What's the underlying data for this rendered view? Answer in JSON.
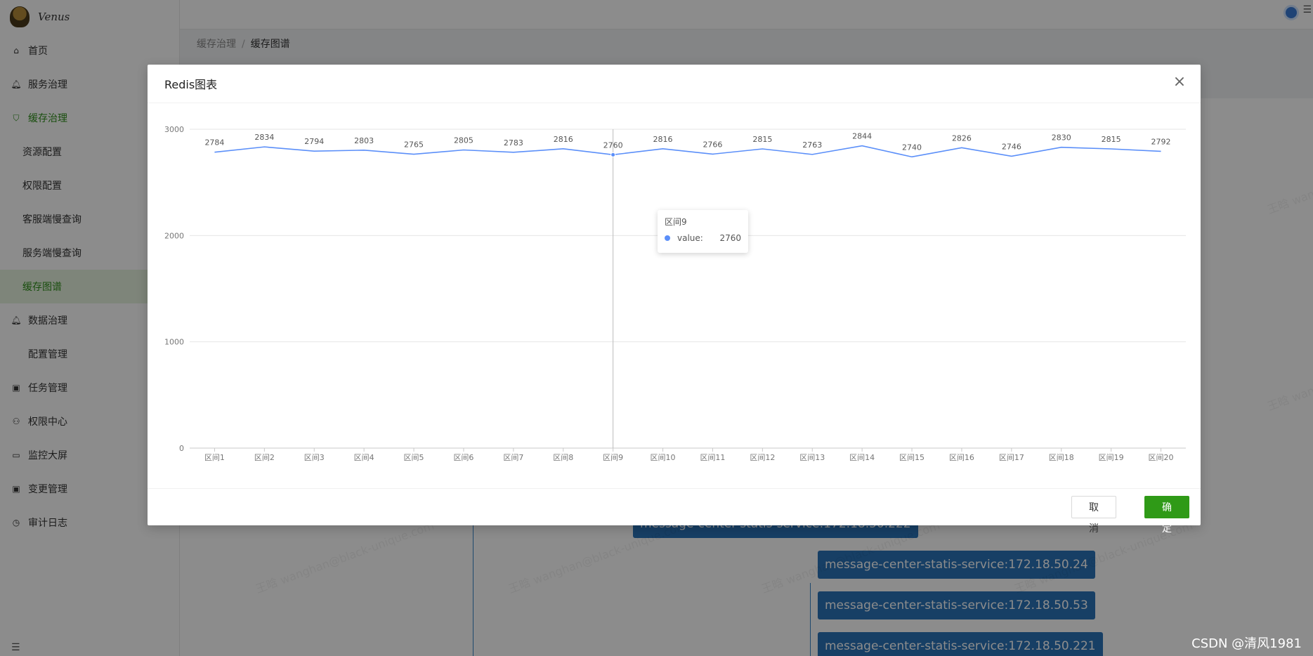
{
  "app": {
    "brand": "Venus"
  },
  "sidebar": {
    "items": [
      {
        "label": "首页",
        "icon": "home-icon"
      },
      {
        "label": "服务治理",
        "icon": "bell-icon"
      },
      {
        "label": "缓存治理",
        "icon": "shield-icon"
      },
      {
        "label": "资源配置"
      },
      {
        "label": "权限配置"
      },
      {
        "label": "客服端慢查询"
      },
      {
        "label": "服务端慢查询"
      },
      {
        "label": "缓存图谱"
      },
      {
        "label": "数据治理",
        "icon": "bell-icon"
      },
      {
        "label": "配置管理",
        "icon": "apple-icon"
      },
      {
        "label": "任务管理",
        "icon": "play-icon"
      },
      {
        "label": "权限中心",
        "icon": "users-icon"
      },
      {
        "label": "监控大屏",
        "icon": "monitor-icon"
      },
      {
        "label": "变更管理",
        "icon": "play-icon"
      },
      {
        "label": "审计日志",
        "icon": "clock-icon"
      }
    ]
  },
  "breadcrumb": {
    "parent": "缓存治理",
    "current": "缓存图谱"
  },
  "graph": {
    "nodes": [
      "message-center-statis-service:172.18.50.222",
      "message-center-statis-service:172.18.50.24",
      "message-center-statis-service:172.18.50.53",
      "message-center-statis-service:172.18.50.221"
    ]
  },
  "watermark": "王晗 wanghan@black-unique.com",
  "modal": {
    "title": "Redis图表",
    "cancel": "取 消",
    "ok": "确 定"
  },
  "tooltip": {
    "title": "区间9",
    "label": "value:",
    "value": "2760"
  },
  "chart_data": {
    "type": "line",
    "categories": [
      "区间1",
      "区间2",
      "区间3",
      "区间4",
      "区间5",
      "区间6",
      "区间7",
      "区间8",
      "区间9",
      "区间10",
      "区间11",
      "区间12",
      "区间13",
      "区间14",
      "区间15",
      "区间16",
      "区间17",
      "区间18",
      "区间19",
      "区间20"
    ],
    "values": [
      2784,
      2834,
      2794,
      2803,
      2765,
      2805,
      2783,
      2816,
      2760,
      2816,
      2766,
      2815,
      2763,
      2844,
      2740,
      2826,
      2746,
      2830,
      2815,
      2792
    ],
    "y_ticks": [
      0,
      1000,
      2000,
      3000
    ],
    "ylim": [
      0,
      3000
    ],
    "grid": true,
    "data_labels": true,
    "highlighted_index": 8,
    "color": "#5b8ff9"
  },
  "footer_credit": "CSDN @清风1981"
}
